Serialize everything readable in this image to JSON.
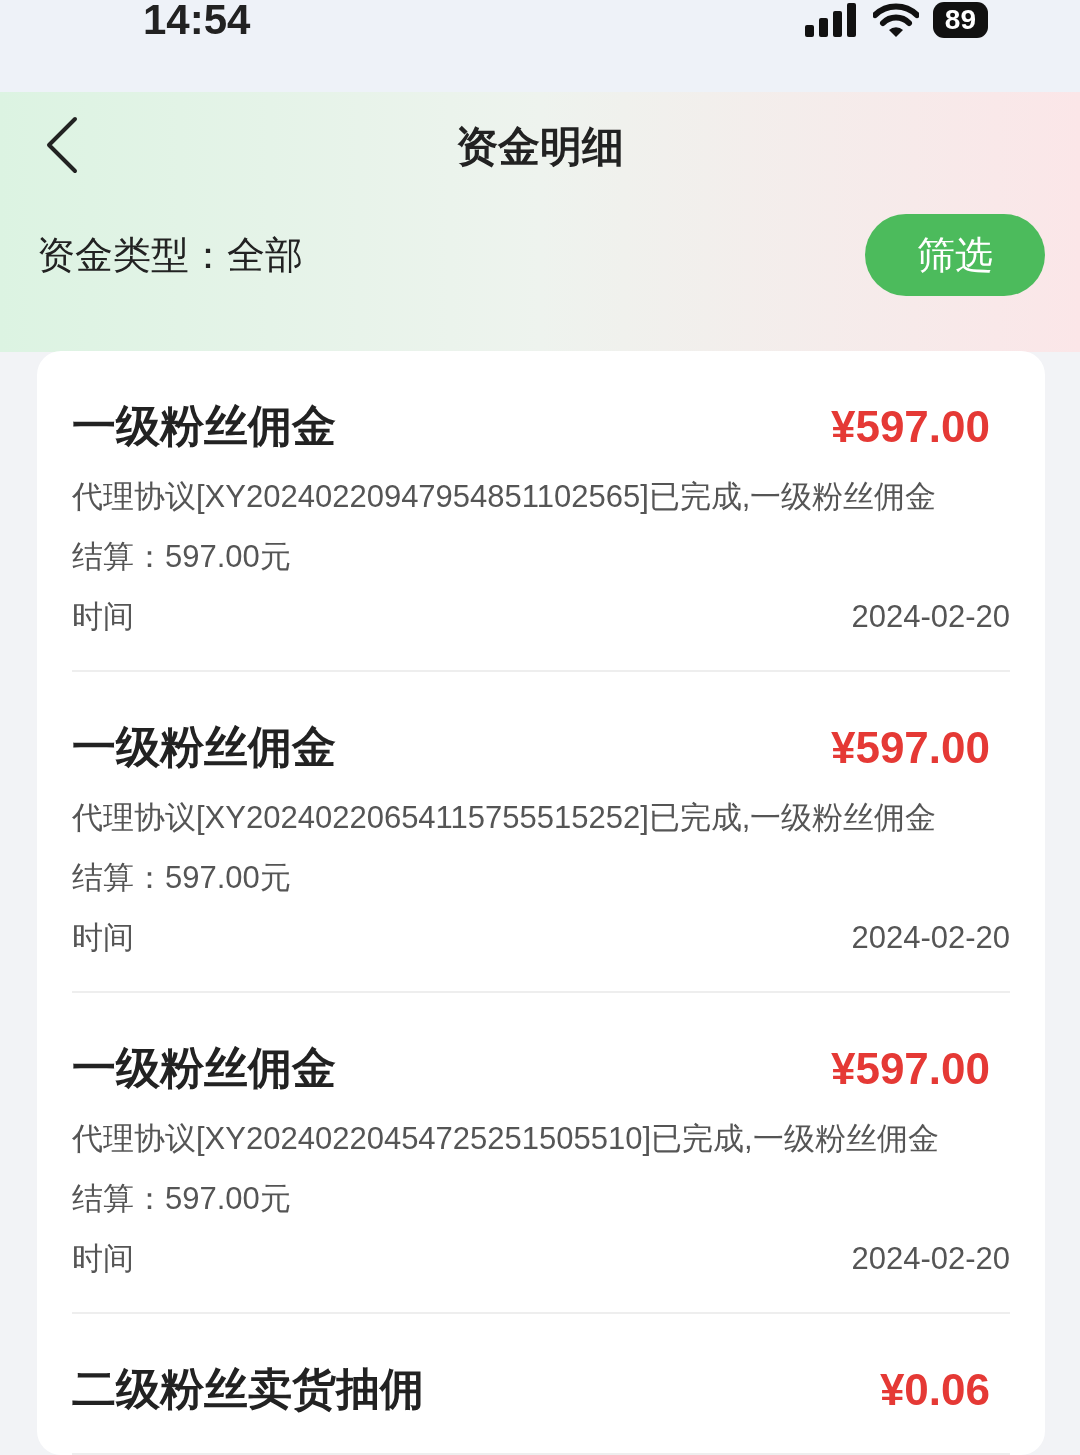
{
  "status_bar": {
    "time": "14:54",
    "battery": "89"
  },
  "header": {
    "title": "资金明细"
  },
  "filter": {
    "label": "资金类型：",
    "value": "全部",
    "button": "筛选"
  },
  "records": [
    {
      "title": "一级粉丝佣金",
      "amount": "¥597.00",
      "description": "代理协议[XY20240220947954851102565]已完成,一级粉丝佣金",
      "settlement": "结算：597.00元",
      "time_label": "时间",
      "date": "2024-02-20"
    },
    {
      "title": "一级粉丝佣金",
      "amount": "¥597.00",
      "description": "代理协议[XY20240220654115755515252]已完成,一级粉丝佣金",
      "settlement": "结算：597.00元",
      "time_label": "时间",
      "date": "2024-02-20"
    },
    {
      "title": "一级粉丝佣金",
      "amount": "¥597.00",
      "description": "代理协议[XY20240220454725251505510]已完成,一级粉丝佣金",
      "settlement": "结算：597.00元",
      "time_label": "时间",
      "date": "2024-02-20"
    },
    {
      "title": "二级粉丝卖货抽佣",
      "amount": "¥0.06"
    }
  ]
}
